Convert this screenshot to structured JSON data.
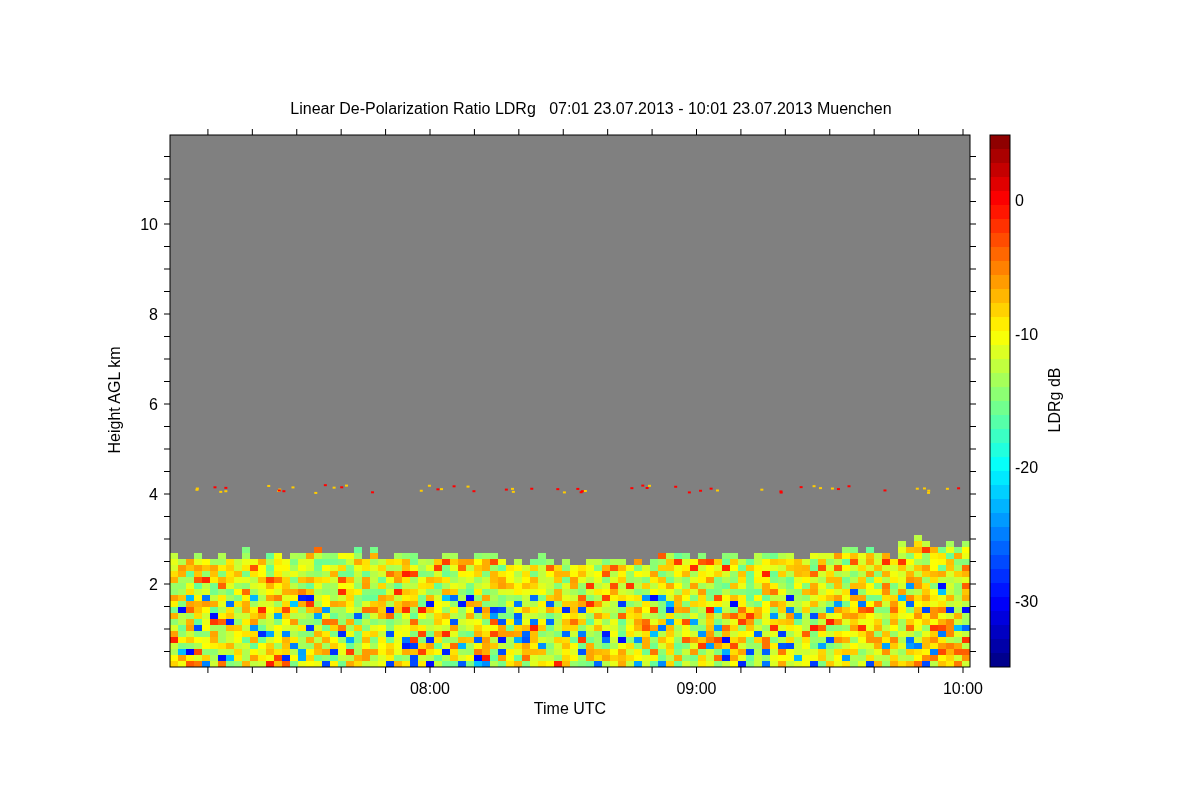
{
  "figure": {
    "title": "Linear De-Polarization Ratio LDRg   07:01 23.07.2013 - 10:01 23.07.2013 Muenchen",
    "x_axis": {
      "label": "Time UTC",
      "ticks": [
        "08:00",
        "09:00",
        "10:00"
      ]
    },
    "y_axis": {
      "label": "Height AGL km",
      "ticks": [
        "10",
        "8",
        "6",
        "4",
        "2"
      ]
    },
    "colorbar": {
      "label": "LDRg dB",
      "ticks": [
        "0",
        "-10",
        "-20",
        "-30"
      ]
    }
  }
}
